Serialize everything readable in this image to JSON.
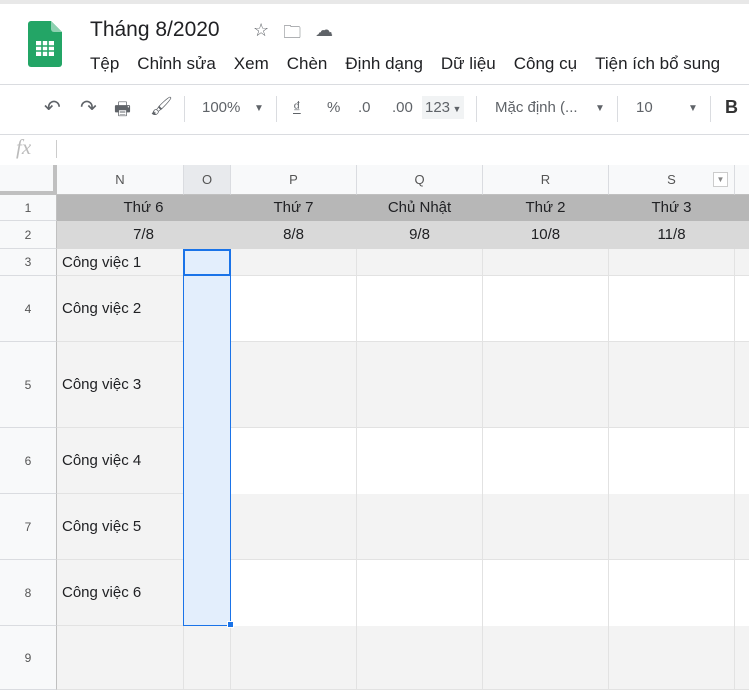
{
  "doc": {
    "title": "Tháng 8/2020"
  },
  "menu": [
    "Tệp",
    "Chỉnh sửa",
    "Xem",
    "Chèn",
    "Định dạng",
    "Dữ liệu",
    "Công cụ",
    "Tiện ích bổ sung"
  ],
  "toolbar": {
    "zoom": "100%",
    "currency": "₫",
    "percent": "%",
    "dec_less": ".0",
    "dec_more": ".00",
    "format": "123",
    "font": "Mặc định (...",
    "size": "10",
    "bold": "B"
  },
  "formula": {
    "fx": "fx",
    "value": ""
  },
  "columns": [
    "N",
    "O",
    "P",
    "Q",
    "R",
    "S"
  ],
  "rows": [
    "1",
    "2",
    "3",
    "4",
    "5",
    "6",
    "7",
    "8",
    "9"
  ],
  "row1": [
    "Thứ 6",
    "Thứ 7",
    "Chủ Nhật",
    "Thứ 2",
    "Thứ 3"
  ],
  "row2": [
    "7/8",
    "8/8",
    "9/8",
    "10/8",
    "11/8"
  ],
  "tasks": [
    "Công việc 1",
    "Công việc 2",
    "Công việc 3",
    "Công việc 4",
    "Công việc 5",
    "Công việc 6"
  ]
}
